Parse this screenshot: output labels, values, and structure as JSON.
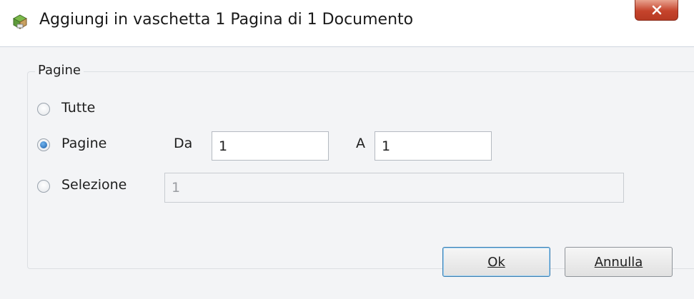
{
  "window": {
    "title": "Aggiungi in vaschetta 1 Pagina di 1 Documento",
    "icon": "printer-tray-icon",
    "close_symbol": "x"
  },
  "group": {
    "legend": "Pagine"
  },
  "options": {
    "all_label": "Tutte",
    "pages_label": "Pagine",
    "selection_label": "Selezione",
    "selected": "pages"
  },
  "range": {
    "from_label": "Da",
    "from_value": "1",
    "to_label": "A",
    "to_value": "1"
  },
  "selection": {
    "value": "1",
    "enabled": false
  },
  "buttons": {
    "ok_label": "Ok",
    "cancel_label": "Annulla"
  },
  "colors": {
    "close_button": "#c5432b",
    "radio_checked": "#1c5ea8",
    "default_button_border": "#3c7fb1"
  }
}
